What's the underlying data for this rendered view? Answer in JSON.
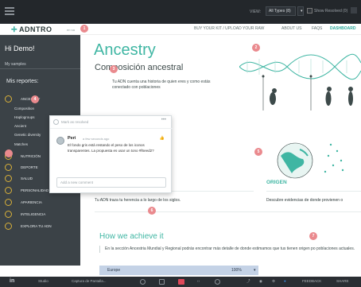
{
  "topbar": {
    "view_label": "VIEW:",
    "filter_value": "All Types (8)",
    "show_resolved_label": "Show Resolved (0)"
  },
  "site": {
    "logo_text": "ADNTRO",
    "logo_sub": "en·ca",
    "nav": [
      "BUY YOUR KIT / UPLOAD YOUR RAW",
      "ABOUT US",
      "FAQS",
      "DASHBOARD"
    ]
  },
  "sidebar": {
    "greeting": "Hi Demo!",
    "samples": "My samples",
    "reports_title": "Mis reportes:",
    "items": [
      {
        "label": "ANCESTRY"
      },
      {
        "label": "NUTRICIÓN"
      },
      {
        "label": "DEPORTE"
      },
      {
        "label": "SALUD"
      },
      {
        "label": "PERSONALIDAD"
      },
      {
        "label": "APARIENCIA"
      },
      {
        "label": "INTELIGENCIA"
      },
      {
        "label": "EXPLORA TU ADN"
      }
    ],
    "subitems": [
      "Composition",
      "Haplogroups",
      "Ancient",
      "Genetic diversity",
      "Matches"
    ]
  },
  "main": {
    "title": "Ancestry",
    "subtitle": "Composición ancestral",
    "lead": "Tu ADN cuenta una historia de quien eres y como estás conectado con poblaciones",
    "herencia": "Tu ADN traza tu herencia a lo largo de los siglos.",
    "origen_title": "ORIGEN",
    "origen_text": "Descubre evidencias de donde provienen o",
    "achieve_title": "How we achieve it",
    "achieve_text": "En la sección Ancestria Mundial y Regional podrás encontrar más detalle de donde estimamos que tus tienen origen po poblaciones actuales.",
    "europe_label": "Europe",
    "europe_value": "100%"
  },
  "pins": [
    "1",
    "2",
    "3",
    "4",
    "5",
    "6",
    "7"
  ],
  "comment": {
    "resolve": "Mark as resolved",
    "author": "Peri",
    "time": "a few seconds ago",
    "body": "El fondo gris está restando el peso de los iconos transparentes. La propuesta es usar un tono #f6eed2?",
    "placeholder": "Add a new comment"
  },
  "taskbar": {
    "app_logo": "in",
    "items": [
      "Studio",
      "Captura de Pantalla..."
    ],
    "right_labels": [
      "FEEDBACK",
      "SHARE"
    ]
  },
  "colors": {
    "teal": "#3fb6a3",
    "sidebar": "#3b4247",
    "pin": "#ea8a8e"
  }
}
